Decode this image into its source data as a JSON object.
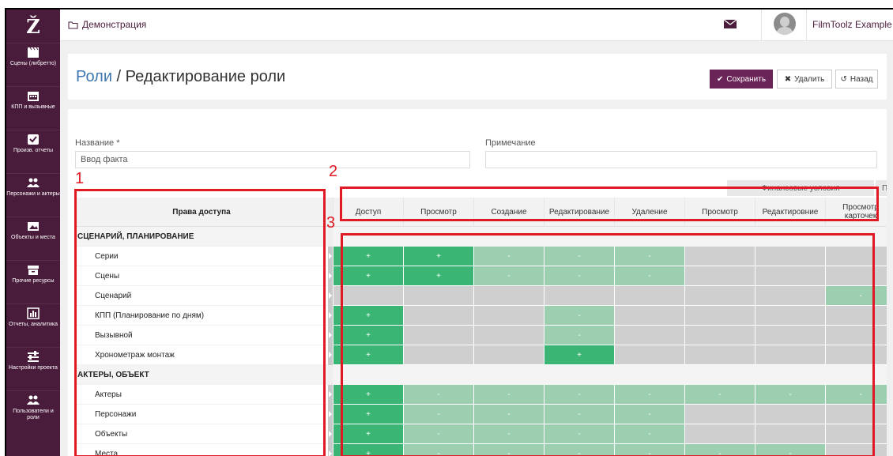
{
  "app": {
    "logo": "Ž",
    "breadcrumb": "Демонстрация",
    "user_name": "FilmToolz Example"
  },
  "sidebar": {
    "items": [
      {
        "label": "Сцены (либретто)",
        "icon": "clapperboard-icon"
      },
      {
        "label": "КПП и вызывные",
        "icon": "calendar-icon"
      },
      {
        "label": "Произв. отчеты",
        "icon": "checkbox-icon"
      },
      {
        "label": "Персонажи и актеры",
        "icon": "users-icon"
      },
      {
        "label": "Объекты и места",
        "icon": "image-icon"
      },
      {
        "label": "Прочие ресурсы",
        "icon": "box-icon"
      },
      {
        "label": "Отчеты, аналитика",
        "icon": "bar-chart-icon"
      },
      {
        "label": "Настройки проекта",
        "icon": "sliders-icon"
      },
      {
        "label": "Пользователи и роли",
        "icon": "users-icon"
      }
    ]
  },
  "header": {
    "title_link": "Роли",
    "title_sep": " / ",
    "title_rest": "Редактирование роли",
    "save_label": "Сохранить",
    "delete_label": "Удалить",
    "back_label": "Назад"
  },
  "form": {
    "name_label": "Название *",
    "name_value": "Ввод факта",
    "note_label": "Примечание",
    "note_value": ""
  },
  "table": {
    "group_headers": {
      "finance": "Финансовые условия",
      "priv": "Привя"
    },
    "rights_header": "Права доступа",
    "columns": [
      "Доступ",
      "Просмотр",
      "Создание",
      "Редактирование",
      "Удаление",
      "Просмотр",
      "Редактировние",
      "Просмотр карточек"
    ],
    "rows": [
      {
        "type": "cat",
        "name": "СЦЕНАРИЙ, ПЛАНИРОВАНИЕ"
      },
      {
        "type": "item",
        "name": "Серии",
        "cells": [
          "+",
          "+",
          "-",
          "-",
          "-",
          "",
          "",
          ""
        ]
      },
      {
        "type": "item",
        "name": "Сцены",
        "cells": [
          "+",
          "+",
          "-",
          "-",
          "-",
          "",
          "",
          ""
        ]
      },
      {
        "type": "item",
        "name": "Сценарий",
        "cells": [
          "",
          "",
          "",
          "",
          "",
          "",
          "",
          "-"
        ]
      },
      {
        "type": "item",
        "name": "КПП (Планирование по дням)",
        "cells": [
          "+",
          "",
          "",
          "-",
          "",
          "",
          "",
          ""
        ]
      },
      {
        "type": "item",
        "name": "Вызывной",
        "cells": [
          "+",
          "",
          "",
          "-",
          "",
          "",
          "",
          ""
        ]
      },
      {
        "type": "item",
        "name": "Хронометраж монтаж",
        "cells": [
          "+",
          "",
          "",
          "+",
          "",
          "",
          "",
          ""
        ]
      },
      {
        "type": "cat",
        "name": "АКТЕРЫ, ОБЪЕКТ"
      },
      {
        "type": "item",
        "name": "Актеры",
        "cells": [
          "+",
          "-",
          "-",
          "-",
          "-",
          "-",
          "-",
          "-"
        ]
      },
      {
        "type": "item",
        "name": "Персонажи",
        "cells": [
          "+",
          "-",
          "-",
          "-",
          "-",
          "",
          "",
          ""
        ]
      },
      {
        "type": "item",
        "name": "Объекты",
        "cells": [
          "+",
          "-",
          "-",
          "-",
          "-",
          "",
          "",
          ""
        ]
      },
      {
        "type": "item",
        "name": "Места",
        "cells": [
          "+",
          "-",
          "-",
          "-",
          "-",
          "-",
          "-",
          ""
        ]
      }
    ],
    "styles": [
      [
        "",
        "",
        "",
        "",
        "",
        "",
        "",
        ""
      ],
      [
        "g",
        "g",
        "l",
        "l",
        "l",
        "x",
        "x",
        "x"
      ],
      [
        "g",
        "g",
        "l",
        "l",
        "l",
        "x",
        "x",
        "x"
      ],
      [
        "x",
        "x",
        "x",
        "x",
        "x",
        "x",
        "x",
        "l"
      ],
      [
        "g",
        "x",
        "x",
        "l",
        "x",
        "x",
        "x",
        "x"
      ],
      [
        "g",
        "x",
        "x",
        "l",
        "x",
        "x",
        "x",
        "x"
      ],
      [
        "g",
        "x",
        "x",
        "g",
        "x",
        "x",
        "x",
        "x"
      ],
      [
        "",
        "",
        "",
        "",
        "",
        "",
        "",
        ""
      ],
      [
        "g",
        "l",
        "l",
        "l",
        "l",
        "l",
        "l",
        "l"
      ],
      [
        "g",
        "l",
        "l",
        "l",
        "l",
        "x",
        "x",
        "x"
      ],
      [
        "g",
        "l",
        "l",
        "l",
        "l",
        "x",
        "x",
        "x"
      ],
      [
        "g",
        "l",
        "l",
        "l",
        "l",
        "l",
        "l",
        "x"
      ]
    ]
  },
  "annotations": {
    "one": "1",
    "two": "2",
    "three": "3",
    "color": "#e01a24"
  }
}
